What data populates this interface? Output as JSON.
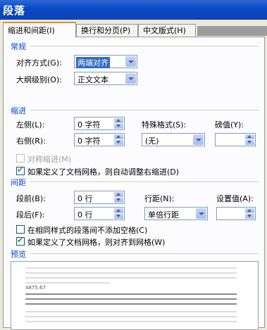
{
  "window": {
    "title": "段落"
  },
  "tabs": [
    {
      "label": "缩进和间距(I)"
    },
    {
      "label": "换行和分页(P)"
    },
    {
      "label": "中文版式(H)"
    }
  ],
  "general": {
    "section": "常规",
    "alignment_label": "对齐方式(G):",
    "alignment_value": "两端对齐",
    "outline_label": "大纲级别(O):",
    "outline_value": "正文文本"
  },
  "indent": {
    "section": "缩进",
    "left_label": "左侧(L):",
    "left_value": "0 字符",
    "right_label": "右侧(R):",
    "right_value": "0 字符",
    "special_label": "特殊格式(S):",
    "special_value": "(无)",
    "by_label": "磅值(Y):",
    "by_value": "",
    "mirror_label": "对称缩进(M)",
    "mirror_checked": false,
    "auto_adjust_label": "如果定义了文档网格，则自动调整右缩进(D)",
    "auto_adjust_checked": true
  },
  "spacing": {
    "section": "间距",
    "before_label": "段前(B):",
    "before_value": "0 行",
    "after_label": "段后(F):",
    "after_value": "0 行",
    "line_label": "行距(N):",
    "line_value": "单倍行距",
    "at_label": "设置值(A):",
    "at_value": "",
    "no_space_label": "在相同样式的段落间不添加空格(C)",
    "no_space_checked": false,
    "snap_grid_label": "如果定义了文档网格，则对齐到网格(W)",
    "snap_grid_checked": true
  },
  "preview": {
    "section": "预览",
    "sample_number": "4875.67"
  }
}
